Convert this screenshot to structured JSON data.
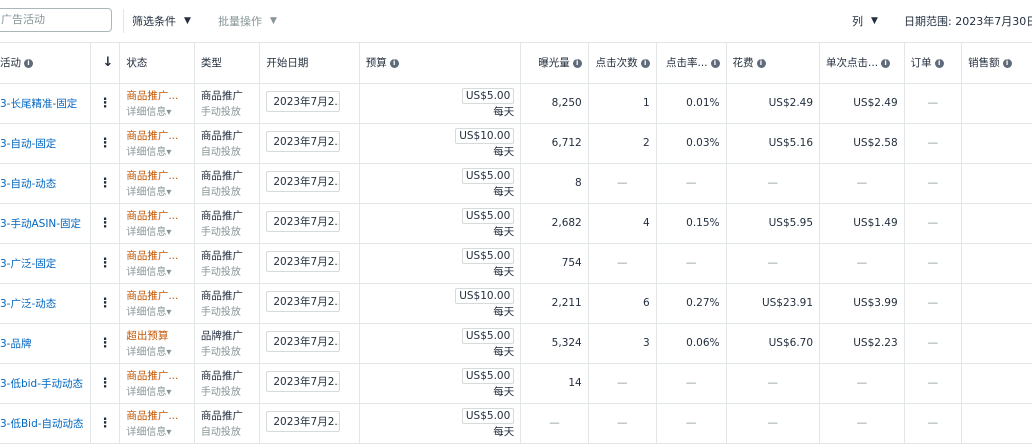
{
  "toolbar": {
    "search_placeholder": "广告活动",
    "filter_label": "筛选条件",
    "bulk_label": "批量操作",
    "columns_label": "列",
    "date_range": "日期范围: 2023年7月30日"
  },
  "headers": {
    "campaign": "活动",
    "status": "状态",
    "type": "类型",
    "start": "开始日期",
    "budget": "预算",
    "impressions": "曝光量",
    "clicks": "点击次数",
    "ctr": "点击率...",
    "spend": "花费",
    "cpc": "单次点击...",
    "orders": "订单",
    "sales": "销售额"
  },
  "rows": [
    {
      "name": "3-长尾精准-固定",
      "status": "商品推广...",
      "status_detail": "详细信息▾",
      "type": "商品推广",
      "type_sub": "手动投放",
      "start": "2023年7月2...",
      "budget": "US$5.00",
      "per": "每天",
      "impressions": "8,250",
      "clicks": "1",
      "ctr": "0.01%",
      "spend": "US$2.49",
      "cpc": "US$2.49",
      "orders": "—",
      "sales": ""
    },
    {
      "name": "3-自动-固定",
      "status": "商品推广...",
      "status_detail": "详细信息▾",
      "type": "商品推广",
      "type_sub": "自动投放",
      "start": "2023年7月2...",
      "budget": "US$10.00",
      "per": "每天",
      "impressions": "6,712",
      "clicks": "2",
      "ctr": "0.03%",
      "spend": "US$5.16",
      "cpc": "US$2.58",
      "orders": "—",
      "sales": ""
    },
    {
      "name": "3-自动-动态",
      "status": "商品推广...",
      "status_detail": "详细信息▾",
      "type": "商品推广",
      "type_sub": "自动投放",
      "start": "2023年7月2...",
      "budget": "US$5.00",
      "per": "每天",
      "impressions": "8",
      "clicks": "—",
      "ctr": "—",
      "spend": "—",
      "cpc": "—",
      "orders": "—",
      "sales": ""
    },
    {
      "name": "3-手动ASIN-固定",
      "status": "商品推广...",
      "status_detail": "详细信息▾",
      "type": "商品推广",
      "type_sub": "手动投放",
      "start": "2023年7月2...",
      "budget": "US$5.00",
      "per": "每天",
      "impressions": "2,682",
      "clicks": "4",
      "ctr": "0.15%",
      "spend": "US$5.95",
      "cpc": "US$1.49",
      "orders": "—",
      "sales": ""
    },
    {
      "name": "3-广泛-固定",
      "status": "商品推广...",
      "status_detail": "详细信息▾",
      "type": "商品推广",
      "type_sub": "手动投放",
      "start": "2023年7月2...",
      "budget": "US$5.00",
      "per": "每天",
      "impressions": "754",
      "clicks": "—",
      "ctr": "—",
      "spend": "—",
      "cpc": "—",
      "orders": "—",
      "sales": ""
    },
    {
      "name": "3-广泛-动态",
      "status": "商品推广...",
      "status_detail": "详细信息▾",
      "type": "商品推广",
      "type_sub": "手动投放",
      "start": "2023年7月2...",
      "budget": "US$10.00",
      "per": "每天",
      "impressions": "2,211",
      "clicks": "6",
      "ctr": "0.27%",
      "spend": "US$23.91",
      "cpc": "US$3.99",
      "orders": "—",
      "sales": ""
    },
    {
      "name": "3-品牌",
      "status": "超出预算",
      "status_detail": "详细信息▾",
      "type": "品牌推广",
      "type_sub": "手动投放",
      "start": "2023年7月2...",
      "budget": "US$5.00",
      "per": "每天",
      "impressions": "5,324",
      "clicks": "3",
      "ctr": "0.06%",
      "spend": "US$6.70",
      "cpc": "US$2.23",
      "orders": "—",
      "sales": ""
    },
    {
      "name": "3-低bid-手动动态",
      "status": "商品推广...",
      "status_detail": "详细信息▾",
      "type": "商品推广",
      "type_sub": "手动投放",
      "start": "2023年7月2...",
      "budget": "US$5.00",
      "per": "每天",
      "impressions": "14",
      "clicks": "—",
      "ctr": "—",
      "spend": "—",
      "cpc": "—",
      "orders": "—",
      "sales": ""
    },
    {
      "name": "3-低Bid-自动动态",
      "status": "商品推广...",
      "status_detail": "详细信息▾",
      "type": "商品推广",
      "type_sub": "自动投放",
      "start": "2023年7月2...",
      "budget": "US$5.00",
      "per": "每天",
      "impressions": "—",
      "clicks": "—",
      "ctr": "—",
      "spend": "—",
      "cpc": "—",
      "orders": "—",
      "sales": ""
    }
  ]
}
